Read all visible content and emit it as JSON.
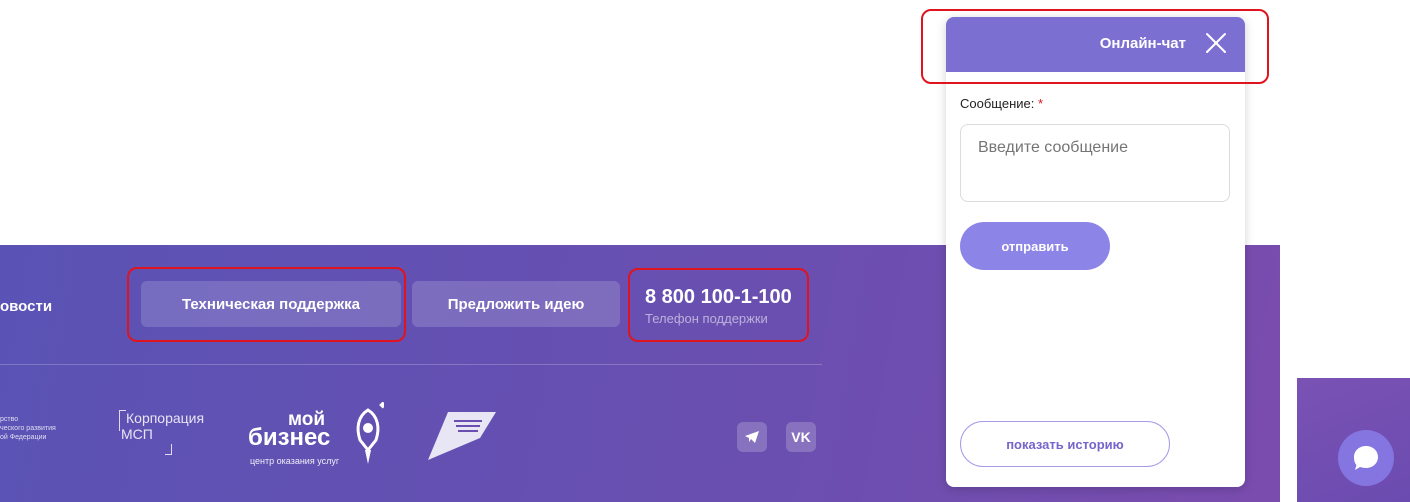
{
  "footer": {
    "news_link": "овости",
    "support_button": "Техническая поддержка",
    "idea_button": "Предложить идею",
    "phone_number": "8 800 100-1-100",
    "phone_caption": "Телефон поддержки",
    "logos": {
      "ministry_lines": [
        "рство",
        "ческого развития",
        "ой Федерации"
      ],
      "corporation_line1": "Корпорация",
      "corporation_line2": "МСП",
      "my_business_word1": "мой",
      "my_business_word2": "бизнес",
      "my_business_tagline": "центр оказания услуг",
      "national_projects_icon": "national-projects-logo"
    },
    "social": {
      "telegram_icon": "telegram-icon",
      "vk_label": "VK"
    }
  },
  "chat": {
    "title": "Онлайн-чат",
    "close_icon": "close-icon",
    "message_label": "Сообщение:",
    "required_mark": "*",
    "message_placeholder": "Введите сообщение",
    "send_button": "отправить",
    "history_button": "показать историю"
  },
  "launcher": {
    "icon": "chat-bubble-icon"
  },
  "colors": {
    "footer_gradient_start": "#5a53b5",
    "footer_gradient_end": "#7a4cae",
    "chat_header": "#7c6fd2",
    "send_button": "#8d84e8",
    "highlight_outline": "#e0141e"
  }
}
